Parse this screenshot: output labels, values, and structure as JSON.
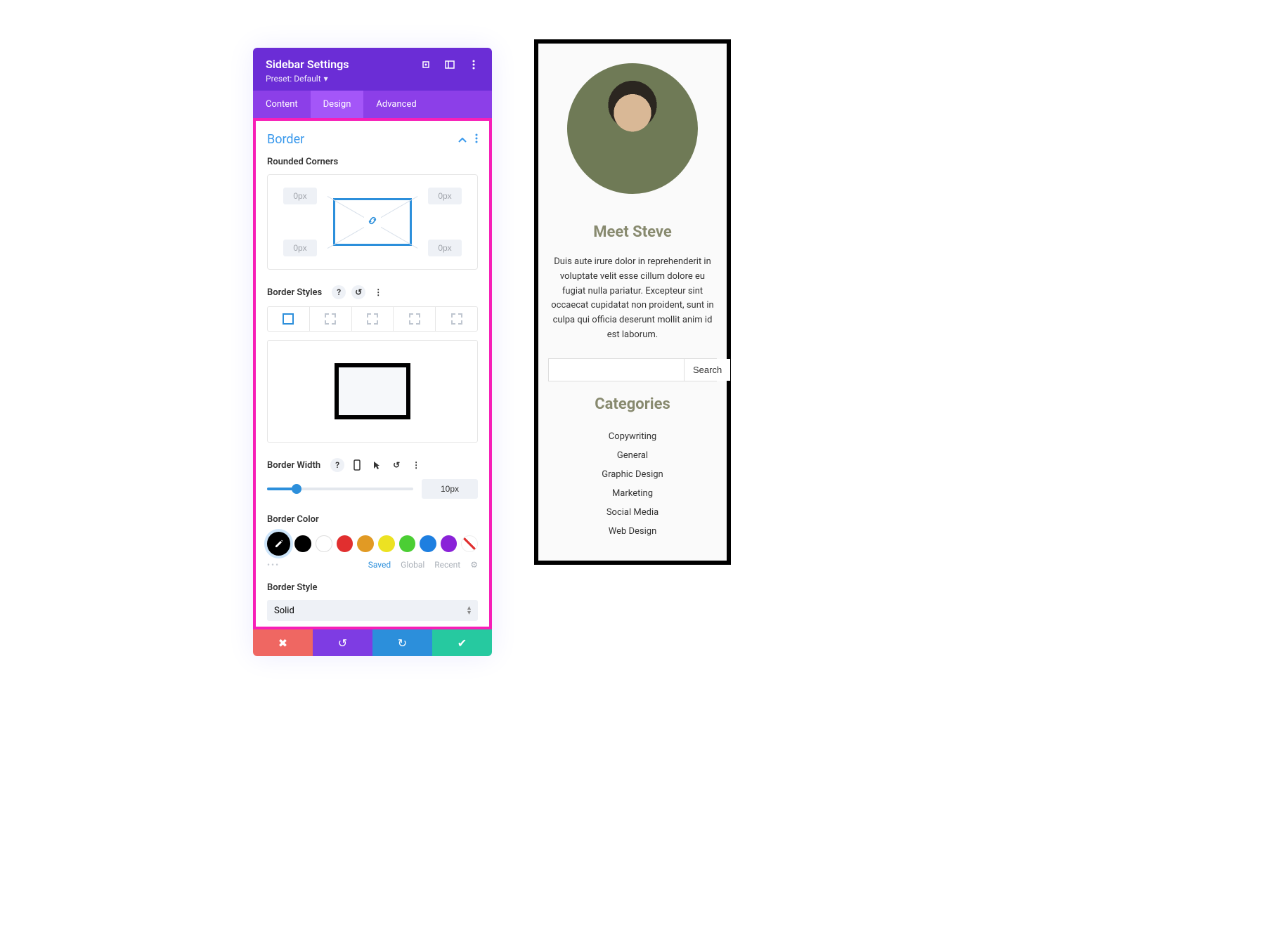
{
  "panel": {
    "title": "Sidebar Settings",
    "preset_label": "Preset: Default",
    "tabs": {
      "content": "Content",
      "design": "Design",
      "advanced": "Advanced",
      "active": "design"
    },
    "section_title": "Border",
    "rounded_corners_label": "Rounded Corners",
    "corners": {
      "tl": "0px",
      "tr": "0px",
      "bl": "0px",
      "br": "0px"
    },
    "border_styles_label": "Border Styles",
    "border_width_label": "Border Width",
    "border_width_value": "10px",
    "border_color_label": "Border Color",
    "color_tabs": {
      "saved": "Saved",
      "global": "Global",
      "recent": "Recent"
    },
    "border_style_label": "Border Style",
    "border_style_value": "Solid"
  },
  "preview": {
    "title": "Meet Steve",
    "description": "Duis aute irure dolor in reprehenderit in voluptate velit esse cillum dolore eu fugiat nulla pariatur. Excepteur sint occaecat cupidatat non proident, sunt in culpa qui officia deserunt mollit anim id est laborum.",
    "search_button": "Search",
    "categories_title": "Categories",
    "categories": [
      "Copywriting",
      "General",
      "Graphic Design",
      "Marketing",
      "Social Media",
      "Web Design"
    ]
  }
}
